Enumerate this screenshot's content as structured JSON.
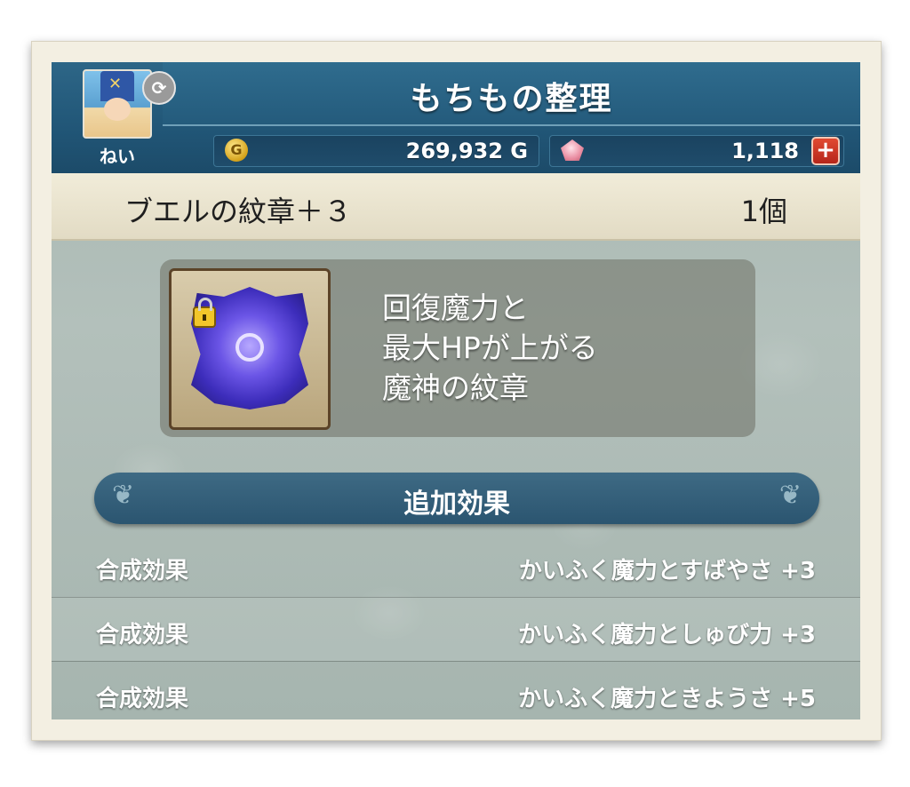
{
  "header": {
    "title": "もちもの整理",
    "player_name": "ねい",
    "gold": "269,932 G",
    "gems": "1,118"
  },
  "icons": {
    "swap": "swap-icon",
    "coin": "gold-coin-icon",
    "gem": "gem-icon",
    "plus": "plus-icon",
    "lock": "lock-icon",
    "crest": "crest-emblem"
  },
  "colors": {
    "header_blue": "#215677",
    "plus_red": "#d23a26",
    "background": "#a7b7b1"
  },
  "item": {
    "name": "ブエルの紋章＋３",
    "count": "1個",
    "description": [
      "回復魔力と",
      "最大HPが上がる",
      "魔神の紋章"
    ]
  },
  "section": {
    "title": "追加効果"
  },
  "effects": [
    {
      "label": "合成効果",
      "value": "かいふく魔力とすばやさ +3"
    },
    {
      "label": "合成効果",
      "value": "かいふく魔力としゅび力 +3"
    },
    {
      "label": "合成効果",
      "value": "かいふく魔力ときようさ +5"
    }
  ]
}
